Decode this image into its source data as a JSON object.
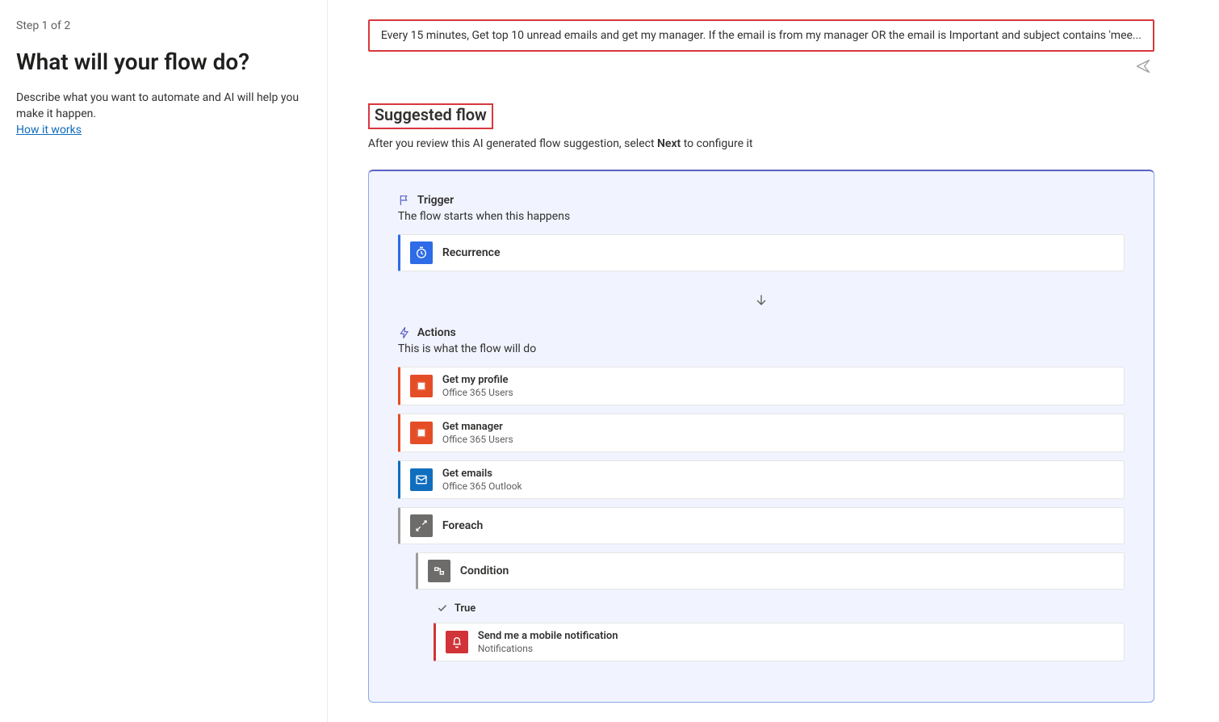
{
  "left": {
    "step_label": "Step 1 of 2",
    "title": "What will your flow do?",
    "description": "Describe what you want to automate and AI will help you make it happen.",
    "how_it_works": "How it works"
  },
  "prompt": {
    "text": "Every 15 minutes, Get top 10 unread emails and get my manager. If the email is from my manager OR the email is Important and subject contains 'mee..."
  },
  "suggested": {
    "heading": "Suggested flow",
    "review_prefix": "After you review this AI generated flow suggestion, select ",
    "review_strong": "Next",
    "review_suffix": " to configure it"
  },
  "sections": {
    "trigger_label": "Trigger",
    "trigger_sub": "The flow starts when this happens",
    "actions_label": "Actions",
    "actions_sub": "This is what the flow will do"
  },
  "cards": {
    "recurrence": {
      "title": "Recurrence"
    },
    "get_profile": {
      "title": "Get my profile",
      "sub": "Office 365 Users"
    },
    "get_manager": {
      "title": "Get manager",
      "sub": "Office 365 Users"
    },
    "get_emails": {
      "title": "Get emails",
      "sub": "Office 365 Outlook"
    },
    "foreach": {
      "title": "Foreach"
    },
    "condition": {
      "title": "Condition"
    },
    "true_label": "True",
    "notify": {
      "title": "Send me a mobile notification",
      "sub": "Notifications"
    }
  }
}
